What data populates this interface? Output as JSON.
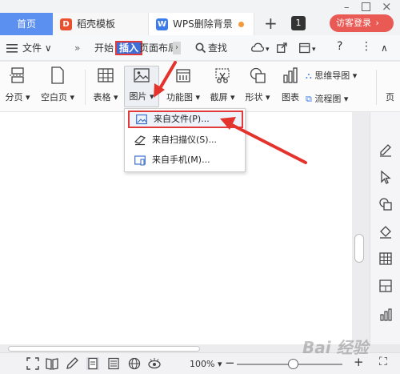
{
  "tabs": {
    "home": "首页",
    "template": "稻壳模板",
    "document": "WPS删除背景",
    "add": "+",
    "grid_count": "1",
    "login": "访客登录"
  },
  "menu": {
    "file": "文件",
    "more": "»",
    "start": "开始",
    "insert": "插入",
    "page_layout": "页面布局",
    "search": "查找",
    "help": "?",
    "more_options": "⋮"
  },
  "ribbon": {
    "page_break": "分页",
    "blank_page": "空白页",
    "table": "表格",
    "picture": "图片",
    "function_chart": "功能图",
    "screenshot": "截屏",
    "shape": "形状",
    "chart": "图表",
    "mind_map": "思维导图",
    "flowchart": "流程图"
  },
  "picture_menu": {
    "from_file": "来自文件(P)...",
    "from_scanner": "来自扫描仪(S)...",
    "from_phone": "来自手机(M)..."
  },
  "status": {
    "zoom": "100%"
  },
  "watermark": "Bai 经验",
  "colors": {
    "accent_blue": "#5b8ff0",
    "insert_tab": "#3f6fd6",
    "highlight_red": "#e03a3a",
    "login_red": "#ea5a55"
  }
}
